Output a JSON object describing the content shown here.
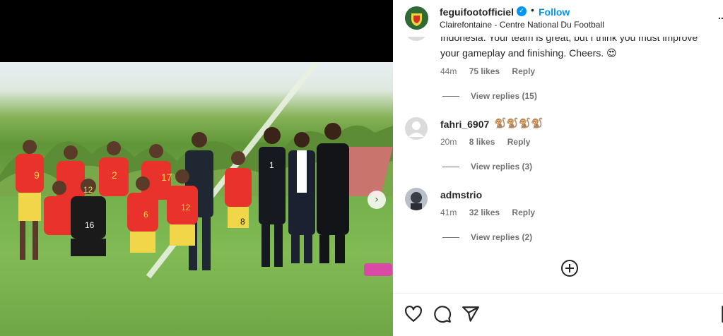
{
  "post": {
    "username": "feguifootofficiel",
    "follow_label": "Follow",
    "separator": "•",
    "location": "Clairefontaine - Centre National Du Football",
    "more_label": "..."
  },
  "comments": [
    {
      "partial_line": "Indonesia. Your team is great, but I think you must improve",
      "text": "your gameplay and finishing. Cheers.",
      "emoji": "😍",
      "time": "44m",
      "likes": "75 likes",
      "reply_label": "Reply",
      "view_replies": "View replies (15)"
    },
    {
      "username": "fahri_6907",
      "emoji": "🐒🐒🐒🐒",
      "time": "20m",
      "likes": "8 likes",
      "reply_label": "Reply",
      "view_replies": "View replies (3)"
    },
    {
      "username": "admstrio",
      "time": "41m",
      "likes": "32 likes",
      "reply_label": "Reply",
      "view_replies": "View replies (2)"
    }
  ],
  "jersey_numbers": [
    "9",
    "2",
    "17",
    "12",
    "6",
    "12",
    "8",
    "16",
    "1"
  ],
  "icons": [
    "heart-icon",
    "comment-icon",
    "share-icon",
    "load-more-plus-icon",
    "verified-badge-icon",
    "carousel-next-icon"
  ],
  "colors": {
    "accent": "#0095f6",
    "text": "#262626",
    "muted": "#737373",
    "jersey": "#e8322b"
  }
}
